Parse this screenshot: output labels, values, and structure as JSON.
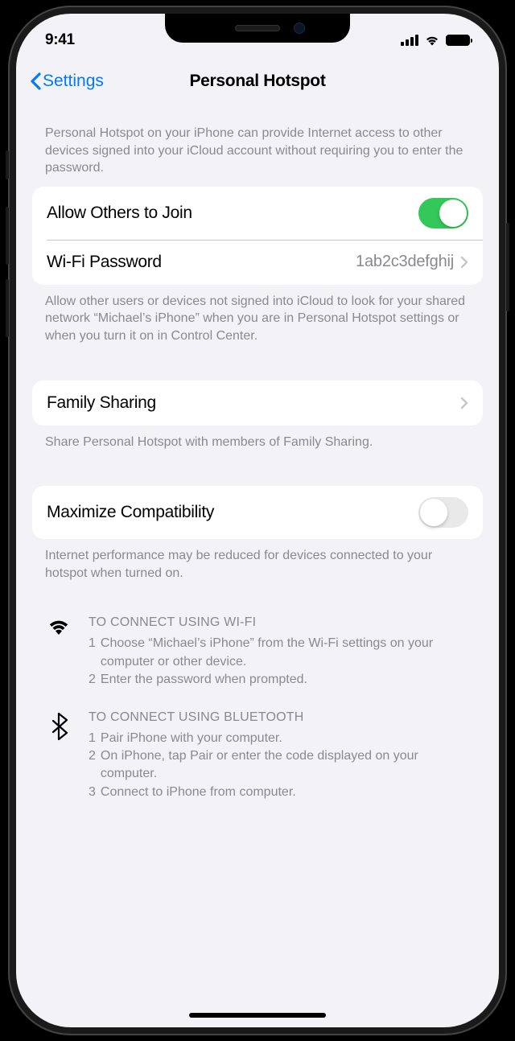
{
  "status_bar": {
    "time": "9:41"
  },
  "nav": {
    "back_label": "Settings",
    "title": "Personal Hotspot"
  },
  "intro_note": "Personal Hotspot on your iPhone can provide Internet access to other devices signed into your iCloud account without requiring you to enter the password.",
  "group1": {
    "allow_others": {
      "label": "Allow Others to Join",
      "enabled": true
    },
    "wifi_password": {
      "label": "Wi-Fi Password",
      "value": "1ab2c3defghij"
    }
  },
  "group1_note": "Allow other users or devices not signed into iCloud to look for your shared network “Michael’s iPhone” when you are in Personal Hotspot settings or when you turn it on in Control Center.",
  "group2": {
    "family_sharing": {
      "label": "Family Sharing"
    }
  },
  "group2_note": "Share Personal Hotspot with members of Family Sharing.",
  "group3": {
    "maximize_compat": {
      "label": "Maximize Compatibility",
      "enabled": false
    }
  },
  "group3_note": "Internet performance may be reduced for devices connected to your hotspot when turned on.",
  "instructions": {
    "wifi": {
      "header": "TO CONNECT USING WI-FI",
      "steps": [
        "Choose “Michael’s iPhone” from the Wi-Fi settings on your computer or other device.",
        "Enter the password when prompted."
      ]
    },
    "bluetooth": {
      "header": "TO CONNECT USING BLUETOOTH",
      "steps": [
        "Pair iPhone with your computer.",
        "On iPhone, tap Pair or enter the code displayed on your computer.",
        "Connect to iPhone from computer."
      ]
    }
  }
}
